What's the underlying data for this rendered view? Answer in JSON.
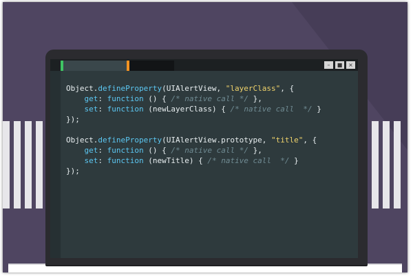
{
  "window_controls": [
    {
      "name": "minimize",
      "glyph": "–"
    },
    {
      "name": "maximize",
      "glyph": "■"
    },
    {
      "name": "close",
      "glyph": "×"
    }
  ],
  "code_lines": [
    [
      [
        "pl",
        "Object."
      ],
      [
        "kw",
        "defineProperty"
      ],
      [
        "pl",
        "(UIAlertView, "
      ],
      [
        "str",
        "\"layerClass\""
      ],
      [
        "pl",
        ", {"
      ]
    ],
    [
      [
        "pl",
        "    "
      ],
      [
        "kw",
        "get"
      ],
      [
        "pl",
        ": "
      ],
      [
        "kw",
        "function"
      ],
      [
        "pl",
        " () { "
      ],
      [
        "cm",
        "/* native call */"
      ],
      [
        "pl",
        " },"
      ]
    ],
    [
      [
        "pl",
        "    "
      ],
      [
        "kw",
        "set"
      ],
      [
        "pl",
        ": "
      ],
      [
        "kw",
        "function"
      ],
      [
        "pl",
        " (newLayerClass) { "
      ],
      [
        "cm",
        "/* native call  */"
      ],
      [
        "pl",
        " }"
      ]
    ],
    [
      [
        "pl",
        "});"
      ]
    ],
    [
      [
        "pl",
        ""
      ]
    ],
    [
      [
        "pl",
        "Object."
      ],
      [
        "kw",
        "defineProperty"
      ],
      [
        "pl",
        "(UIAlertView.prototype, "
      ],
      [
        "str",
        "\"title\""
      ],
      [
        "pl",
        ", {"
      ]
    ],
    [
      [
        "pl",
        "    "
      ],
      [
        "kw",
        "get"
      ],
      [
        "pl",
        ": "
      ],
      [
        "kw",
        "function"
      ],
      [
        "pl",
        " () { "
      ],
      [
        "cm",
        "/* native call */"
      ],
      [
        "pl",
        " },"
      ]
    ],
    [
      [
        "pl",
        "    "
      ],
      [
        "kw",
        "set"
      ],
      [
        "pl",
        ": "
      ],
      [
        "kw",
        "function"
      ],
      [
        "pl",
        " (newTitle) { "
      ],
      [
        "cm",
        "/* native call  */"
      ],
      [
        "pl",
        " }"
      ]
    ],
    [
      [
        "pl",
        "});"
      ]
    ]
  ],
  "colors": {
    "background": "#4f4561",
    "editor": "#2e3a3d",
    "keyword": "#5cc7f2",
    "string": "#f0d36b",
    "comment": "#708b93",
    "tab_green": "#3fc464",
    "tab_orange": "#f39322"
  }
}
